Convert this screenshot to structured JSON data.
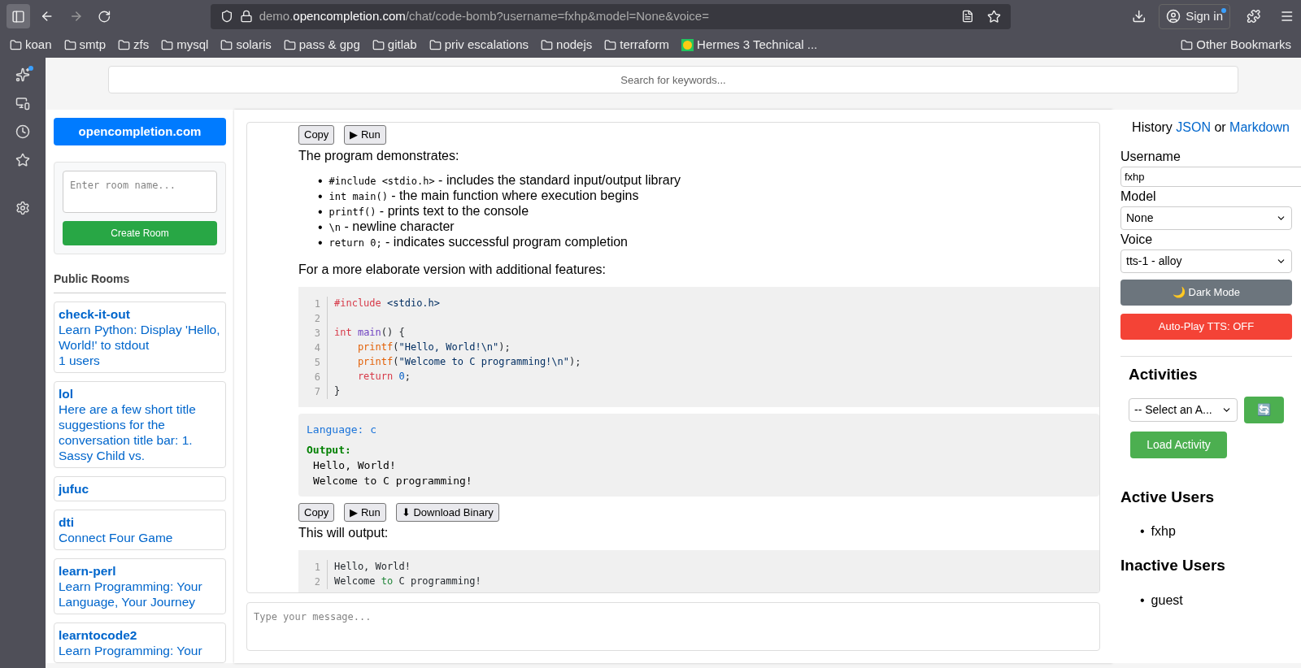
{
  "browser": {
    "url": {
      "prefix": "demo.",
      "domain": "opencompletion.com",
      "path": "/chat/code-bomb?username=fxhp&model=None&voice="
    },
    "sign_in": "Sign in",
    "bookmarks": [
      {
        "kind": "folder",
        "label": "koan"
      },
      {
        "kind": "folder",
        "label": "smtp"
      },
      {
        "kind": "folder",
        "label": "zfs"
      },
      {
        "kind": "folder",
        "label": "mysql"
      },
      {
        "kind": "folder",
        "label": "solaris"
      },
      {
        "kind": "folder",
        "label": "pass & gpg"
      },
      {
        "kind": "folder",
        "label": "gitlab"
      },
      {
        "kind": "folder",
        "label": "priv escalations"
      },
      {
        "kind": "folder",
        "label": "nodejs"
      },
      {
        "kind": "folder",
        "label": "terraform"
      },
      {
        "kind": "site",
        "label": "Hermes 3 Technical ..."
      }
    ],
    "other_bookmarks": "Other Bookmarks"
  },
  "search": {
    "placeholder": "Search for keywords..."
  },
  "left": {
    "site_button": "opencompletion.com",
    "room_input": {
      "placeholder": "Enter room name..."
    },
    "create_button": "Create Room",
    "public_rooms_title": "Public Rooms",
    "rooms": [
      {
        "name": "check-it-out",
        "description": "Learn Python: Display 'Hello, World!' to stdout",
        "users": "1 users"
      },
      {
        "name": "lol",
        "description": "Here are a few short title suggestions for the conversation title bar: 1. Sassy Child vs."
      },
      {
        "name": "jufuc"
      },
      {
        "name": "dti",
        "description": "Connect Four Game"
      },
      {
        "name": "learn-perl",
        "description": "Learn Programming: Your Language, Your Journey"
      },
      {
        "name": "learntocode2",
        "description": "Learn Programming: Your"
      }
    ]
  },
  "chat": {
    "blocks": [
      {
        "kind": "buttons",
        "buttons": [
          "Copy",
          "▶ Run"
        ]
      },
      {
        "kind": "paragraph",
        "text": "The program demonstrates:"
      },
      {
        "kind": "list",
        "marker": "•",
        "items": [
          {
            "code": "#include <stdio.h>",
            "text": " - includes the standard input/output library"
          },
          {
            "code": "int main()",
            "text": " - the main function where execution begins"
          },
          {
            "code": "printf()",
            "text": " - prints text to the console"
          },
          {
            "code": "\\n",
            "text": " - newline character"
          },
          {
            "code": "return 0;",
            "text": " - indicates successful program completion"
          }
        ]
      },
      {
        "kind": "paragraph",
        "text": "For a more elaborate version with additional features:"
      },
      {
        "kind": "code",
        "lines": [
          {
            "number": "1",
            "tokens": [
              {
                "kind": "keyword",
                "text": "#include"
              },
              {
                "kind": "string",
                "text": " <stdio.h>"
              }
            ]
          },
          {
            "number": "2"
          },
          {
            "number": "3",
            "tokens": [
              {
                "kind": "keyword",
                "text": "int"
              },
              {
                "kind": "function",
                "text": " main"
              },
              {
                "kind": "plain",
                "text": "() {"
              }
            ]
          },
          {
            "number": "4",
            "tokens": [
              {
                "kind": "call",
                "text": "    printf"
              },
              {
                "kind": "plain",
                "text": "("
              },
              {
                "kind": "string",
                "text": "\"Hello, World!\\n\""
              },
              {
                "kind": "plain",
                "text": ");"
              }
            ]
          },
          {
            "number": "5",
            "tokens": [
              {
                "kind": "call",
                "text": "    printf"
              },
              {
                "kind": "plain",
                "text": "("
              },
              {
                "kind": "string",
                "text": "\"Welcome to C programming!\\n\""
              },
              {
                "kind": "plain",
                "text": ");"
              }
            ]
          },
          {
            "number": "6",
            "tokens": [
              {
                "kind": "keyword",
                "text": "    return"
              },
              {
                "kind": "number",
                "text": " 0"
              },
              {
                "kind": "plain",
                "text": ";"
              }
            ]
          },
          {
            "number": "7",
            "tokens": [
              {
                "kind": "plain",
                "text": "}"
              }
            ]
          }
        ]
      },
      {
        "kind": "output",
        "language": "Language: c",
        "label": "Output:",
        "lines": [
          "Hello, World!",
          "Welcome to C programming!"
        ]
      },
      {
        "kind": "buttons",
        "buttons": [
          "Copy",
          "▶ Run",
          "⬇ Download Binary"
        ]
      },
      {
        "kind": "paragraph",
        "text": "This will output:"
      },
      {
        "kind": "code",
        "lines": [
          {
            "number": "1",
            "tokens": [
              {
                "kind": "plain",
                "text": "Hello, World!"
              }
            ]
          },
          {
            "number": "2",
            "tokens": [
              {
                "kind": "plain",
                "text": "Welcome "
              },
              {
                "kind": "operator",
                "text": "to"
              },
              {
                "kind": "plain",
                "text": " C programming!"
              }
            ]
          }
        ]
      }
    ],
    "message_input": {
      "placeholder": "Type your message..."
    }
  },
  "right": {
    "history": {
      "prefix": "History ",
      "json_link": "JSON",
      "middle": " or ",
      "markdown_link": "Markdown"
    },
    "username_label": "Username",
    "username_value": "fxhp",
    "model_label": "Model",
    "model_value": "None",
    "voice_label": "Voice",
    "voice_value": "tts-1 - alloy",
    "dark_mode_button": "🌙 Dark Mode",
    "autoplay_button": "Auto-Play TTS: OFF",
    "activities_title": "Activities",
    "activity_select": "-- Select an A...",
    "refresh_button": "🔄",
    "load_button": "Load Activity",
    "list_marker": "•",
    "active_title": "Active Users",
    "active_users": [
      "fxhp"
    ],
    "inactive_title": "Inactive Users",
    "inactive_users": [
      "guest"
    ]
  }
}
